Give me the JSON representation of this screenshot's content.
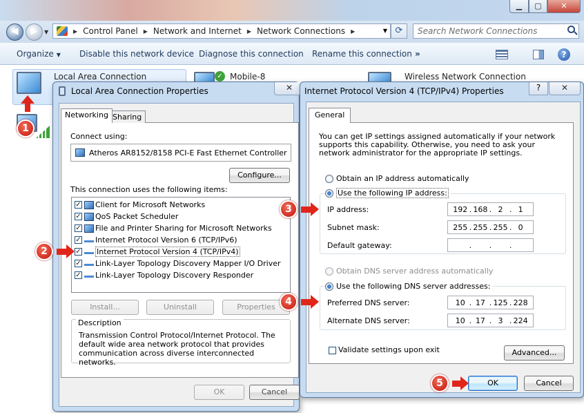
{
  "explorer": {
    "window_controls": {
      "minimize": "▁",
      "maximize": "▢",
      "close": "✕"
    },
    "breadcrumbs": [
      "Control Panel",
      "Network and Internet",
      "Network Connections"
    ],
    "search_placeholder": "Search Network Connections",
    "toolbar": {
      "organize": "Organize",
      "disable": "Disable this network device",
      "diagnose": "Diagnose this connection",
      "rename": "Rename this connection",
      "more": "»"
    },
    "connections": [
      {
        "name": "Local Area Connection"
      },
      {
        "name": "Mobile-8"
      },
      {
        "name": "Wireless Network Connection"
      }
    ]
  },
  "markers": [
    "1",
    "2",
    "3",
    "4",
    "5"
  ],
  "lac_dialog": {
    "title": "Local Area Connection Properties",
    "close": "✕",
    "tabs": [
      "Networking",
      "Sharing"
    ],
    "connect_using_label": "Connect using:",
    "adapter": "Atheros AR8152/8158 PCI-E Fast Ethernet Controller",
    "configure_button": "Configure...",
    "items_label": "This connection uses the following items:",
    "items": [
      {
        "label": "Client for Microsoft Networks",
        "checked": true,
        "icon": "netpc"
      },
      {
        "label": "QoS Packet Scheduler",
        "checked": true,
        "icon": "netpc"
      },
      {
        "label": "File and Printer Sharing for Microsoft Networks",
        "checked": true,
        "icon": "netpc"
      },
      {
        "label": "Internet Protocol Version 6 (TCP/IPv6)",
        "checked": true,
        "icon": "proto"
      },
      {
        "label": "Internet Protocol Version 4 (TCP/IPv4)",
        "checked": true,
        "icon": "proto"
      },
      {
        "label": "Link-Layer Topology Discovery Mapper I/O Driver",
        "checked": true,
        "icon": "proto"
      },
      {
        "label": "Link-Layer Topology Discovery Responder",
        "checked": true,
        "icon": "proto"
      }
    ],
    "install_button": "Install...",
    "uninstall_button": "Uninstall",
    "properties_button": "Properties",
    "description_label": "Description",
    "description_text": "Transmission Control Protocol/Internet Protocol. The default wide area network protocol that provides communication across diverse interconnected networks.",
    "ok_button": "OK",
    "cancel_button": "Cancel"
  },
  "ip_dialog": {
    "title": "Internet Protocol Version 4 (TCP/IPv4) Properties",
    "help": "?",
    "close": "✕",
    "tab": "General",
    "intro": "You can get IP settings assigned automatically if your network supports this capability. Otherwise, you need to ask your network administrator for the appropriate IP settings.",
    "auto_ip": "Obtain an IP address automatically",
    "manual_ip": "Use the following IP address:",
    "ip_label": "IP address:",
    "ip_value": [
      "192",
      "168",
      "2",
      "1"
    ],
    "subnet_label": "Subnet mask:",
    "subnet_value": [
      "255",
      "255",
      "255",
      "0"
    ],
    "gateway_label": "Default gateway:",
    "auto_dns": "Obtain DNS server address automatically",
    "manual_dns": "Use the following DNS server addresses:",
    "preferred_label": "Preferred DNS server:",
    "preferred_value": [
      "10",
      "17",
      "125",
      "228"
    ],
    "alternate_label": "Alternate DNS server:",
    "alternate_value": [
      "10",
      "17",
      "3",
      "224"
    ],
    "validate": "Validate settings upon exit",
    "advanced_button": "Advanced...",
    "ok_button": "OK",
    "cancel_button": "Cancel"
  }
}
